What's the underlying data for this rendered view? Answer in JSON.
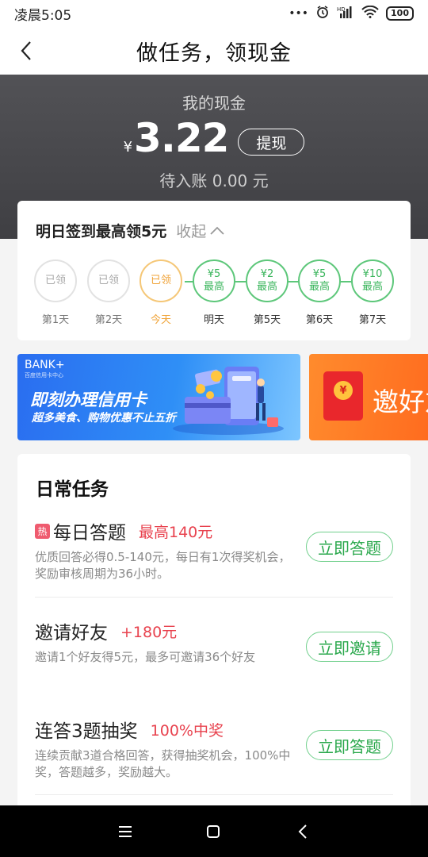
{
  "status_bar": {
    "time": "凌晨5:05",
    "network": "HD",
    "battery": "100"
  },
  "nav": {
    "title": "做任务，领现金"
  },
  "wallet": {
    "label": "我的现金",
    "currency": "¥",
    "amount": "3.22",
    "withdraw_label": "提现",
    "pending": "待入账 0.00 元"
  },
  "signin": {
    "title": "明日签到最高领5元",
    "collapse_label": "收起",
    "days": [
      {
        "line1": "已领",
        "line2": "",
        "label": "第1天",
        "state": "claimed"
      },
      {
        "line1": "已领",
        "line2": "",
        "label": "第2天",
        "state": "claimed"
      },
      {
        "line1": "已领",
        "line2": "",
        "label": "今天",
        "state": "today"
      },
      {
        "line1": "¥5",
        "line2": "最高",
        "label": "明天",
        "state": "next"
      },
      {
        "line1": "¥2",
        "line2": "最高",
        "label": "第5天",
        "state": "future"
      },
      {
        "line1": "¥5",
        "line2": "最高",
        "label": "第6天",
        "state": "future"
      },
      {
        "line1": "¥10",
        "line2": "最高",
        "label": "第7天",
        "state": "future"
      }
    ]
  },
  "banners": [
    {
      "brand": "BANK+",
      "brand_sub": "百度信用卡中心",
      "headline": "即刻办理信用卡",
      "subline": "超多美食、购物优惠不止五折"
    },
    {
      "headline": "邀好友"
    }
  ],
  "daily_tasks": {
    "heading": "日常任务",
    "hot_tag": "热",
    "items": [
      {
        "name": "每日答题",
        "reward": "最高140元",
        "description": "优质回答必得0.5-140元，每日有1次得奖机会，奖励审核周期为36小时。",
        "button": "立即答题",
        "hot": true
      },
      {
        "name": "邀请好友",
        "reward": "+180元",
        "description": "邀请1个好友得5元，最多可邀请36个好友",
        "button": "立即邀请",
        "hot": false
      },
      {
        "name": "连答3题抽奖",
        "reward": "100%中奖",
        "description": "连续贡献3道合格回答，获得抽奖机会，100%中奖，答题越多，奖励越大。",
        "button": "立即答题",
        "hot": false
      }
    ]
  },
  "colors": {
    "accent_green": "#2aa84c",
    "reward_red": "#e8424e",
    "hero_bg": "#4a4a4e",
    "today_orange": "#f0a43a"
  }
}
